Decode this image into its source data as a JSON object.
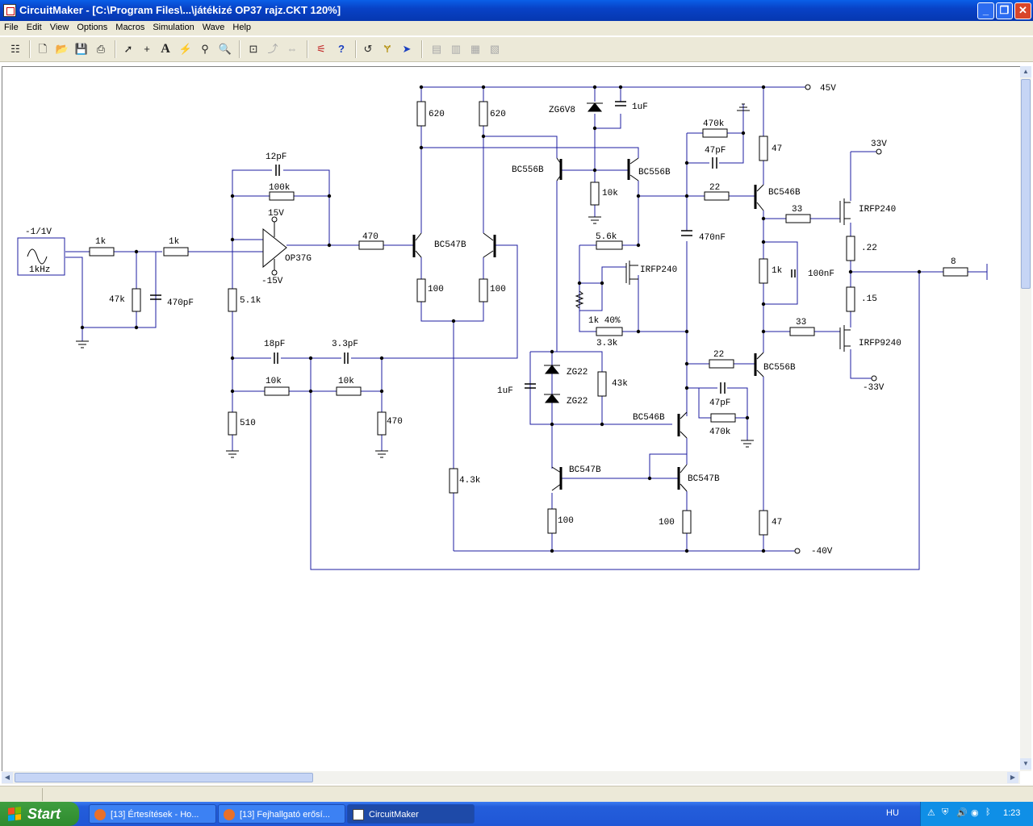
{
  "window": {
    "title": "CircuitMaker - [C:\\Program Files\\...\\játékizé OP37 rajz.CKT 120%]",
    "controls": [
      "minimize",
      "restore",
      "close"
    ]
  },
  "menu": [
    "File",
    "Edit",
    "View",
    "Options",
    "Macros",
    "Simulation",
    "Wave",
    "Help"
  ],
  "toolbar": {
    "buttons": [
      "hierarchy",
      "new",
      "open",
      "save",
      "print",
      "arrow",
      "wire",
      "text",
      "probe",
      "digital-probe",
      "zoom",
      "fit",
      "rotate",
      "mirror",
      "netlist",
      "help",
      "undo",
      "tag",
      "run",
      "ruler-1",
      "ruler-2",
      "ruler-3",
      "ruler-4"
    ]
  },
  "schematic": {
    "rails": {
      "pos": "45V",
      "neg": "-40V",
      "out_pos": "33V",
      "out_neg": "-33V"
    },
    "source": {
      "amp": "-1/1V",
      "freq": "1kHz"
    },
    "opamp": {
      "name": "OP37G",
      "vplus": "15V",
      "vminus": "-15V"
    },
    "labels": {
      "r_in1": "1k",
      "r_in2": "1k",
      "r_47k": "47k",
      "c_470p": "470pF",
      "c_12p": "12pF",
      "r_100k": "100k",
      "r_470a": "470",
      "r_51k": "5.1k",
      "c_18p": "18pF",
      "c_33p": "3.3pF",
      "r_10ka": "10k",
      "r_10kb": "10k",
      "r_510": "510",
      "r_470b": "470",
      "r_620a": "620",
      "r_620b": "620",
      "q_bc547b_pair": "BC547B",
      "r_100a": "100",
      "r_100b": "100",
      "r_43k": "4.3k",
      "z_zg6v8": "ZG6V8",
      "c_1ua": "1uF",
      "q_bc556b_l": "BC556B",
      "q_bc556b_r": "BC556B",
      "r_10kc": "10k",
      "r_5k6": "5.6k",
      "m_irfp240_mid": "IRFP240",
      "pot": "1k 40%",
      "r_3k3": "3.3k",
      "c_1ub": "1uF",
      "z_zg22a": "ZG22",
      "z_zg22b": "ZG22",
      "r_43kb": "43k",
      "q_bc546b_mid": "BC546B",
      "q_bc547b_l": "BC547B",
      "q_bc547b_r": "BC547B",
      "r_100c": "100",
      "r_100d": "100",
      "r_470k_top": "470k",
      "c_47p_top": "47pF",
      "r_22_top": "22",
      "q_bc546b_top": "BC546B",
      "c_470n": "470nF",
      "r_47_top": "47",
      "r_33_top": "33",
      "m_irfp240": "IRFP240",
      "r_022": ".22",
      "r_1k_bias": "1k",
      "c_100n": "100nF",
      "r_015": ".15",
      "r_33_bot": "33",
      "m_irfp9240": "IRFP9240",
      "r_22_bot": "22",
      "q_bc556b_bot": "BC556B",
      "c_47p_bot": "47pF",
      "r_470k_bot": "470k",
      "r_47_bot": "47",
      "r_load": "8"
    }
  },
  "taskbar": {
    "start": "Start",
    "tasks": [
      "[13] Értesítések - Ho...",
      "[13] Fejhallgató erősí...",
      "CircuitMaker"
    ],
    "language": "HU",
    "clock": "1:23"
  }
}
